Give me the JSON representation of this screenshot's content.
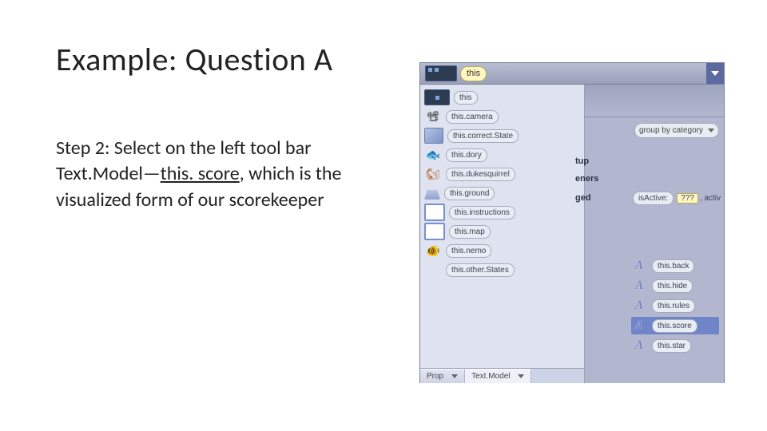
{
  "title": "Example: Question A",
  "body": {
    "line1": "Step 2: Select on the left tool bar Text.Model—",
    "underlined": "this. score",
    "line2": ", which is the visualized form of our scorekeeper"
  },
  "app": {
    "topbar_label": "this",
    "tree": [
      {
        "icon": "obj",
        "label": "this"
      },
      {
        "icon": "cam",
        "glyph": "📽",
        "label": "this.camera"
      },
      {
        "icon": "cube",
        "label": "this.correct.State"
      },
      {
        "icon": "fish",
        "glyph": "🐟",
        "label": "this.dory"
      },
      {
        "icon": "sq",
        "glyph": "🐿",
        "label": "this.dukesquirrel"
      },
      {
        "icon": "trap",
        "label": "this.ground"
      },
      {
        "icon": "rect",
        "label": "this.instructions"
      },
      {
        "icon": "rect",
        "label": "this.map"
      },
      {
        "icon": "ornf",
        "glyph": "🐠",
        "label": "this.nemo"
      },
      {
        "icon": "none",
        "label": "this.other.States"
      }
    ],
    "footer_tabs": {
      "prop": "Prop",
      "textmodel": "Text.Model"
    },
    "group_label": "group by category",
    "right_labels": {
      "l1": "tup",
      "l2": "eners",
      "l3": "ged"
    },
    "stub": {
      "a": "isActive:",
      "q": "???",
      "c": ", activ"
    },
    "a_items": [
      {
        "label": "this.back"
      },
      {
        "label": "this.hide"
      },
      {
        "label": "this.rules"
      },
      {
        "label": "this.score",
        "selected": true
      },
      {
        "label": "this.star"
      }
    ],
    "a_glyph": "A"
  }
}
